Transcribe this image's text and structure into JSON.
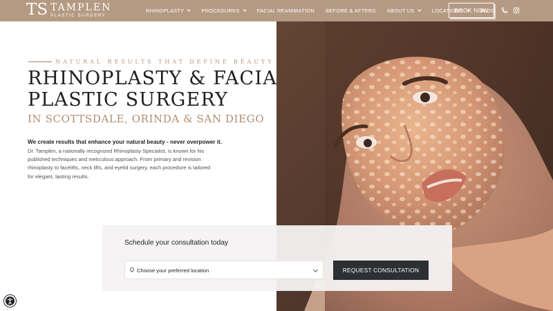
{
  "header": {
    "brand_name": "TAMPLEN",
    "brand_sub": "PLASTIC SURGERY",
    "brand_mark": "TS",
    "nav": [
      {
        "label": "RHINOPLASTY",
        "dropdown": true
      },
      {
        "label": "PROCEDURES",
        "dropdown": true
      },
      {
        "label": "FACIAL REANIMATION",
        "dropdown": false
      },
      {
        "label": "BEFORE & AFTERS",
        "dropdown": false
      },
      {
        "label": "ABOUT US",
        "dropdown": true
      },
      {
        "label": "LOCATIONS",
        "dropdown": true
      },
      {
        "label": "BLOG",
        "dropdown": false
      }
    ],
    "book_label": "BOOK NOW",
    "icons": [
      "phone-icon",
      "instagram-icon"
    ],
    "bar_color": "#b59a83"
  },
  "hero": {
    "eyebrow": "NATURAL RESULTS THAT DEFINE BEAUTY",
    "title_line1": "RHINOPLASTY & FACIAL",
    "title_line2": "PLASTIC SURGERY",
    "subtitle": "IN SCOTTSDALE, ORINDA & SAN DIEGO",
    "lead": "We create results that enhance your natural beauty - never overpower it.",
    "body_lines": [
      "Dr. Tamplen, a nationally recognized Rhinoplasty Specialist, is known for his",
      "published techniques and meticulous approach. From primary and revision",
      "rhinoplasty to facelifts, neck lifts, and eyelid surgery, each procedure is tailored",
      "for elegant, lasting results."
    ],
    "image": "woman-portrait-dappled-light"
  },
  "consultation": {
    "title": "Schedule your consultation today",
    "select_placeholder": "Choose your preferred location",
    "button_label": "REQUEST CONSULTATION",
    "accent": "#2c2f33"
  },
  "accessibility": {
    "icon": "accessibility-icon"
  }
}
